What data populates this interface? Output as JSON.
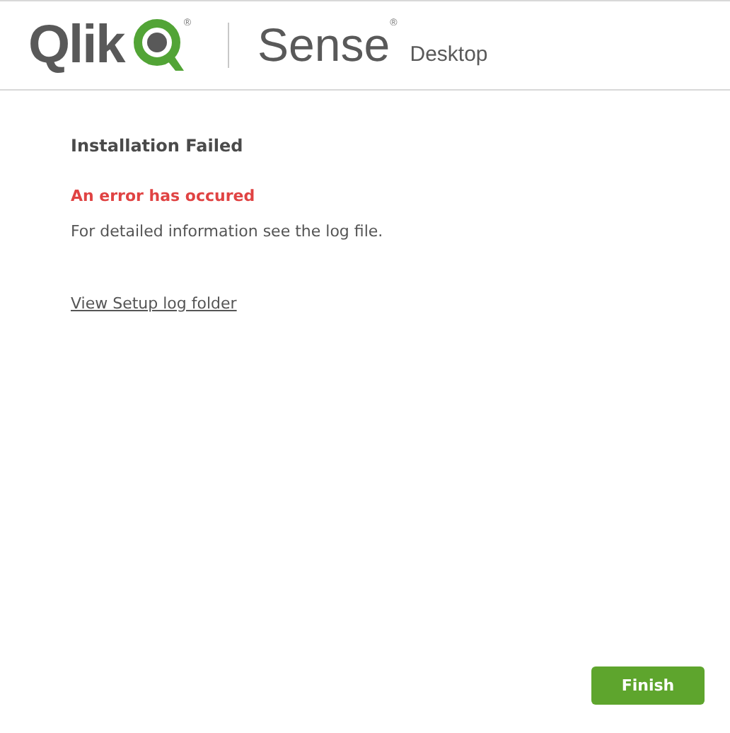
{
  "header": {
    "brand": "Qlik",
    "brand_mark": "®",
    "product": "Sense",
    "product_mark": "®",
    "edition": "Desktop"
  },
  "title": "Installation Failed",
  "error": "An error has occured",
  "message": "For detailed information see the log file.",
  "link": "View Setup log folder",
  "buttons": [
    {
      "label": "Finish",
      "kind": "primary"
    }
  ]
}
